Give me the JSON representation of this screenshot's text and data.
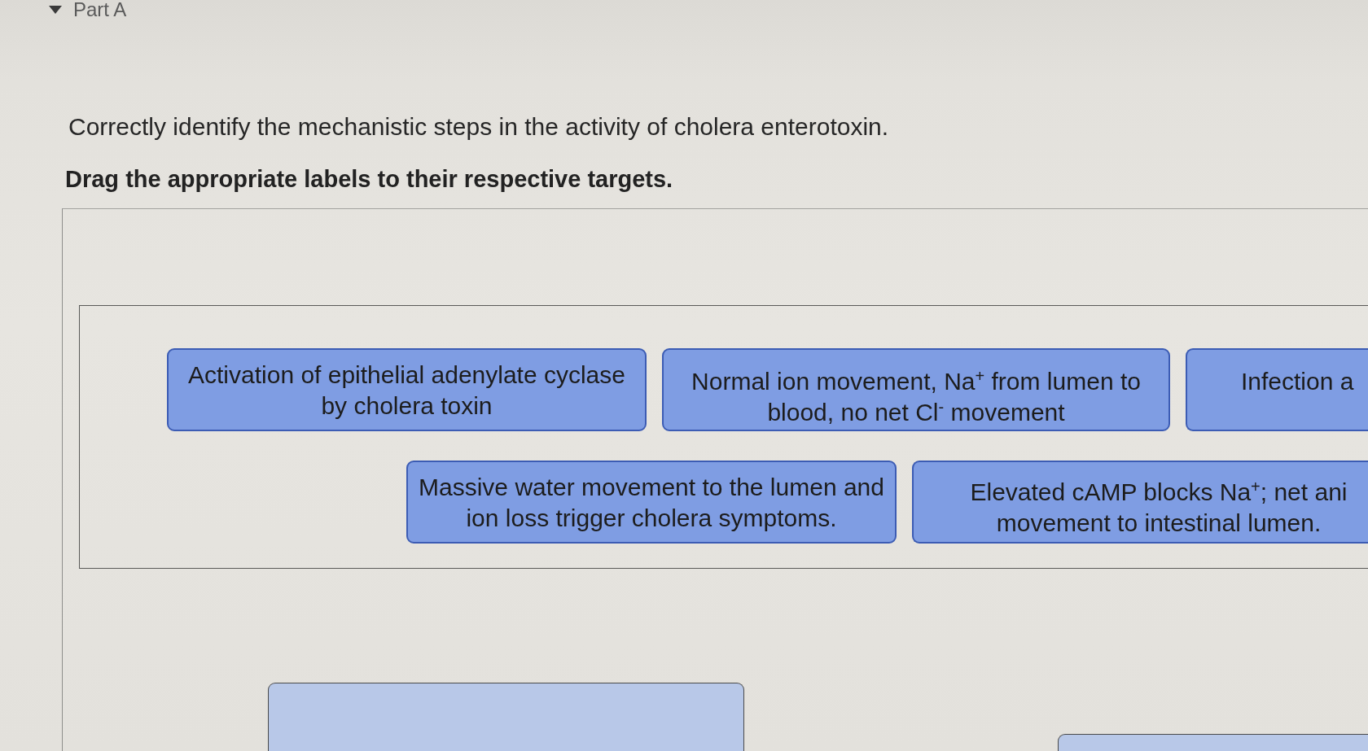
{
  "part": {
    "title": "Part A",
    "expanded": true
  },
  "question": "Correctly identify the mechanistic steps in the activity of cholera enterotoxin.",
  "instruction": "Drag the appropriate labels to their respective targets.",
  "label_bank": {
    "rows": [
      {
        "labels": [
          {
            "lines": [
              "Activation of epithelial adenylate cyclase",
              "by cholera toxin"
            ]
          },
          {
            "lines": [
              "Normal ion movement, Na$^{+}$ from lumen to",
              "blood, no net Cl$^{-}$ movement"
            ]
          },
          {
            "lines": [
              "Infection a"
            ]
          }
        ]
      },
      {
        "labels": [
          {
            "lines": [
              "Massive water movement to the lumen and",
              "ion loss trigger cholera symptoms."
            ]
          },
          {
            "lines": [
              "Elevated cAMP blocks Na$^{+}$; net ani",
              "movement to intestinal lumen."
            ]
          }
        ]
      }
    ]
  },
  "targets": [
    {
      "kind": "drop-zone"
    },
    {
      "kind": "drop-zone"
    }
  ]
}
